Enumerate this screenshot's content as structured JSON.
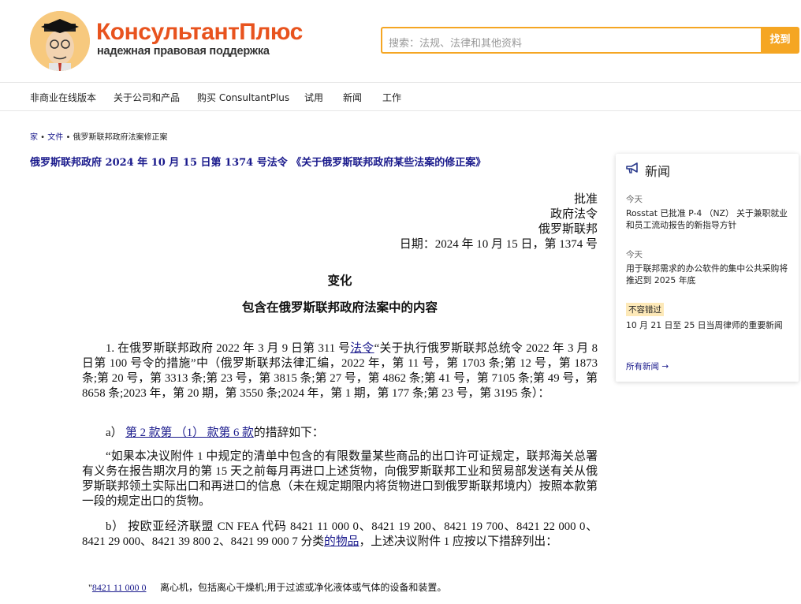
{
  "header": {
    "logo_title": "КонсультантПлюс",
    "logo_subtitle": "надежная правовая поддержка",
    "search_placeholder": "搜索：法规、法律和其他资料",
    "search_button": "找到"
  },
  "nav": [
    "非商业在线版本",
    "关于公司和产品",
    "购买 ConsultantPlus",
    "试用",
    "新闻",
    "工作"
  ],
  "breadcrumb": {
    "home": "家",
    "sep": " • ",
    "docs": "文件",
    "current": "俄罗斯联邦政府法案修正案"
  },
  "document": {
    "title": "俄罗斯联邦政府 2024 年 10 月 15 日第 1374 号法令 《关于俄罗斯联邦政府某些法案的修正案》",
    "approval": [
      "批准",
      "政府法令",
      "俄罗斯联邦",
      "日期：2024 年 10 月 15 日，第 1374 号"
    ],
    "heading1": "变化",
    "heading2": "包含在俄罗斯联邦政府法案中的内容",
    "p1_a": "1. 在俄罗斯联邦政府 2022 年 3 月 9 日第 311 号",
    "p1_link": "法令",
    "p1_b": "“关于执行俄罗斯联邦总统令 2022 年 3 月 8 日第 100 号令的措施”中（俄罗斯联邦法律汇编，2022 年，第 11 号，第 1703 条;第 12 号，第 1873 条;第 20 号，第 3313 条;第 23 号，第 3815 条;第 27 号，第 4862 条;第 41 号，第 7105 条;第 49 号，第 8658 条;2023 年，第 20 期，第 3550 条;2024 年，第 1 期，第 177 条;第 23 号，第 3195 条）：",
    "pa_prefix": "a）",
    "pa_link": "第 2 款第 （1） 款第 6 款",
    "pa_suffix": "的措辞如下：",
    "quote": "“如果本决议附件 1 中规定的清单中包含的有限数量某些商品的出口许可证规定，联邦海关总署有义务在报告期次月的第 15 天之前每月再进口上述货物，向俄罗斯联邦工业和贸易部发送有关从俄罗斯联邦领土实际出口和再进口的信息（未在规定期限内将货物进口到俄罗斯联邦境内）按照本款第一段的规定出口的货物。",
    "pb_a": "b） 按欧亚经济联盟 CN FEA 代码 8421 11 000 0、8421 19 200、8421 19 700、8421 22 000 0、8421 29 000、8421 39 800 2、8421 99 000 7 分类",
    "pb_link": "的物品",
    "pb_b": "，上述决议附件 1 应按以下措辞列出：",
    "table_quote": "\"",
    "table_code": "8421 11 000 0",
    "table_desc": "离心机，包括离心干燥机;用于过滤或净化液体或气体的设备和装置。"
  },
  "news": {
    "title": "新闻",
    "items": [
      {
        "date": "今天",
        "text": "Rosstat 已批准 P-4 （NZ） 关于兼职就业和员工流动报告的新指导方针"
      },
      {
        "date": "今天",
        "text": "用于联邦需求的办公软件的集中公共采购将推迟到 2025 年底"
      },
      {
        "badge": "不容错过",
        "text": "10 月 21 日至 25 日当周律师的重要新闻"
      }
    ],
    "all_link": "所有新闻 →"
  }
}
